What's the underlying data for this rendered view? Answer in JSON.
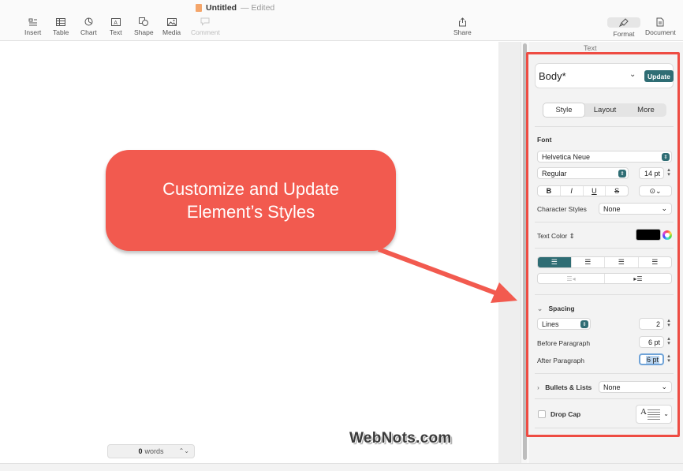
{
  "document": {
    "title": "Untitled",
    "status": "— Edited"
  },
  "toolbar": {
    "insert": "Insert",
    "table": "Table",
    "chart": "Chart",
    "text": "Text",
    "shape": "Shape",
    "media": "Media",
    "comment": "Comment",
    "share": "Share",
    "format": "Format",
    "document": "Document"
  },
  "callout": {
    "line1": "Customize and Update",
    "line2": "Element’s Styles"
  },
  "wordcount": {
    "count": "0",
    "label": "words"
  },
  "watermark": "WebNots.com",
  "inspector": {
    "panel_label": "Text",
    "paragraph_style": "Body*",
    "update_label": "Update",
    "tabs": [
      "Style",
      "Layout",
      "More"
    ],
    "active_tab": "Style",
    "font_heading": "Font",
    "font_family": "Helvetica Neue",
    "font_weight": "Regular",
    "font_size": "14 pt",
    "format_buttons": [
      "B",
      "I",
      "U",
      "S"
    ],
    "character_styles_label": "Character Styles",
    "character_styles_value": "None",
    "text_color_label": "Text Color",
    "text_color": "#000000",
    "spacing_label": "Spacing",
    "lines_label": "Lines",
    "lines_value": "2",
    "before_paragraph_label": "Before Paragraph",
    "before_paragraph_value": "6 pt",
    "after_paragraph_label": "After Paragraph",
    "after_paragraph_value": "6 pt",
    "bullets_label": "Bullets & Lists",
    "bullets_value": "None",
    "drop_cap_label": "Drop Cap"
  },
  "colors": {
    "accent": "#2f6d74",
    "callout": "#f25a4f",
    "highlight": "#ee4c43"
  }
}
